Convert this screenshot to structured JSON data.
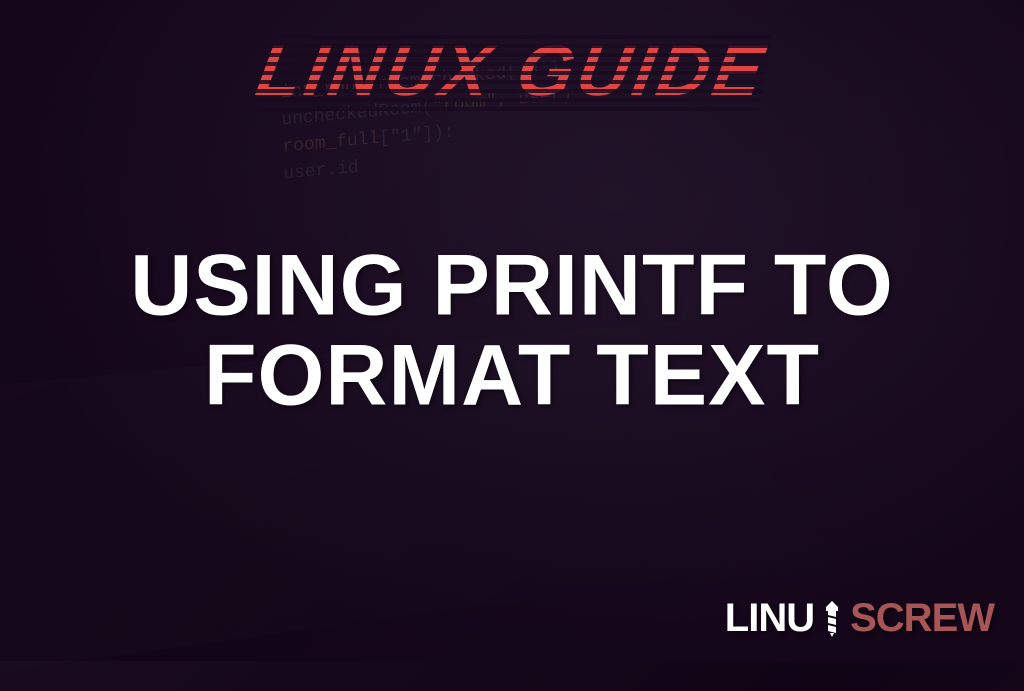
{
  "header": {
    "category": "LINUX GUIDE"
  },
  "main": {
    "title_line1": "USING PRINTF TO",
    "title_line2": "FORMAT TEXT"
  },
  "branding": {
    "logo_prefix": "LINU",
    "logo_suffix": "SCREW"
  }
}
